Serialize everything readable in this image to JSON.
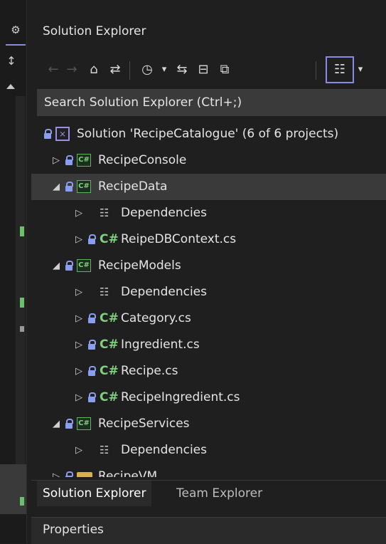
{
  "panel": {
    "title": "Solution Explorer",
    "search_placeholder": "Search Solution Explorer (Ctrl+;)"
  },
  "toolbar": [
    {
      "name": "back-icon",
      "glyph": "←",
      "enabled": false
    },
    {
      "name": "forward-icon",
      "glyph": "→",
      "enabled": false
    },
    {
      "name": "home-icon",
      "glyph": "⌂",
      "enabled": true
    },
    {
      "name": "switch-views-icon",
      "glyph": "⇄",
      "enabled": true
    },
    {
      "name": "pending-changes-filter-icon",
      "glyph": "◷",
      "enabled": true
    },
    {
      "name": "dropdown-arrow-icon",
      "glyph": "▾",
      "enabled": true
    },
    {
      "name": "sync-with-active-document-icon",
      "glyph": "⇆",
      "enabled": true
    },
    {
      "name": "collapse-all-icon",
      "glyph": "⊟",
      "enabled": true
    },
    {
      "name": "show-all-files-icon",
      "glyph": "⧉",
      "enabled": true
    },
    {
      "name": "properties-view-icon",
      "glyph": "☷",
      "enabled": true
    },
    {
      "name": "dropdown-arrow-icon",
      "glyph": "▾",
      "enabled": true
    }
  ],
  "tree": [
    {
      "level": 0,
      "kind": "solution",
      "arrow": "",
      "label": "Solution 'RecipeCatalogue' (6 of 6 projects)",
      "lock": true
    },
    {
      "level": 1,
      "kind": "project",
      "arrow": "▷",
      "label": "RecipeConsole",
      "lock": true
    },
    {
      "level": 1,
      "kind": "project",
      "arrow": "◢",
      "label": "RecipeData",
      "lock": true,
      "selected": true
    },
    {
      "level": 2,
      "kind": "deps",
      "arrow": "▷",
      "label": "Dependencies",
      "lock": false
    },
    {
      "level": 2,
      "kind": "cs",
      "arrow": "▷",
      "label": "ReipeDBContext.cs",
      "lock": true
    },
    {
      "level": 1,
      "kind": "project",
      "arrow": "◢",
      "label": "RecipeModels",
      "lock": true
    },
    {
      "level": 2,
      "kind": "deps",
      "arrow": "▷",
      "label": "Dependencies",
      "lock": false
    },
    {
      "level": 2,
      "kind": "cs",
      "arrow": "▷",
      "label": "Category.cs",
      "lock": true
    },
    {
      "level": 2,
      "kind": "cs",
      "arrow": "▷",
      "label": "Ingredient.cs",
      "lock": true
    },
    {
      "level": 2,
      "kind": "cs",
      "arrow": "▷",
      "label": "Recipe.cs",
      "lock": true
    },
    {
      "level": 2,
      "kind": "cs",
      "arrow": "▷",
      "label": "RecipeIngredient.cs",
      "lock": true
    },
    {
      "level": 1,
      "kind": "project",
      "arrow": "◢",
      "label": "RecipeServices",
      "lock": true
    },
    {
      "level": 2,
      "kind": "deps",
      "arrow": "▷",
      "label": "Dependencies",
      "lock": false
    },
    {
      "level": 1,
      "kind": "folder",
      "arrow": "▷",
      "label": "RecipeVM",
      "lock": true
    }
  ],
  "tabs": {
    "solution_explorer": "Solution Explorer",
    "team_explorer": "Team Explorer"
  },
  "properties": {
    "title": "Properties"
  },
  "colors": {
    "accent": "#8a8ae6",
    "csharp_green": "#7fd07f",
    "lock_blue": "#8a9ef0"
  },
  "csharp_glyph": "C#"
}
